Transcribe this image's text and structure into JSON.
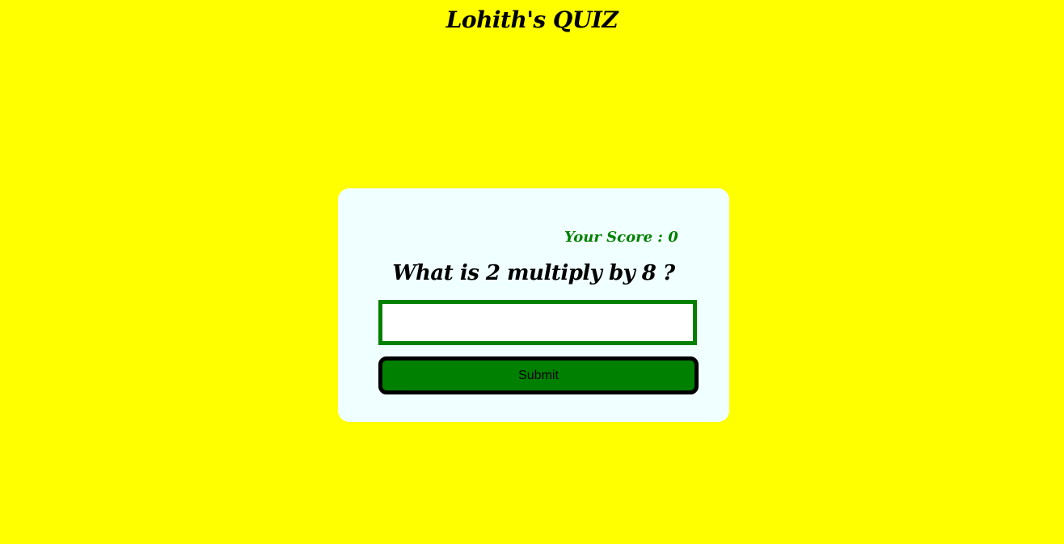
{
  "header": {
    "title": "Lohith's QUIZ"
  },
  "quiz": {
    "score_text": "Your Score : 0",
    "question": "What is 2 multiply by 8 ?",
    "answer_value": "",
    "submit_label": "Submit"
  },
  "colors": {
    "background": "#ffff00",
    "card": "#f0ffff",
    "accent_green": "#008000",
    "text": "#000000"
  }
}
